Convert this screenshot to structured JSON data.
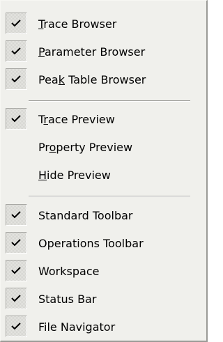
{
  "menu": {
    "items": [
      {
        "pre": "",
        "mn": "T",
        "post": "race Browser",
        "checked": true
      },
      {
        "pre": "",
        "mn": "P",
        "post": "arameter Browser",
        "checked": true
      },
      {
        "pre": "Pea",
        "mn": "k",
        "post": " Table Browser",
        "checked": true
      },
      {
        "pre": "T",
        "mn": "r",
        "post": "ace Preview",
        "checked": true
      },
      {
        "pre": "Pr",
        "mn": "o",
        "post": "perty Preview",
        "checked": false
      },
      {
        "pre": "",
        "mn": "H",
        "post": "ide Preview",
        "checked": false
      },
      {
        "pre": "Standard Toolbar",
        "mn": "",
        "post": "",
        "checked": true
      },
      {
        "pre": "Operations Toolbar",
        "mn": "",
        "post": "",
        "checked": true
      },
      {
        "pre": "Workspace",
        "mn": "",
        "post": "",
        "checked": true
      },
      {
        "pre": "Status Bar",
        "mn": "",
        "post": "",
        "checked": true
      },
      {
        "pre": "File Navigator",
        "mn": "",
        "post": "",
        "checked": true
      }
    ]
  }
}
